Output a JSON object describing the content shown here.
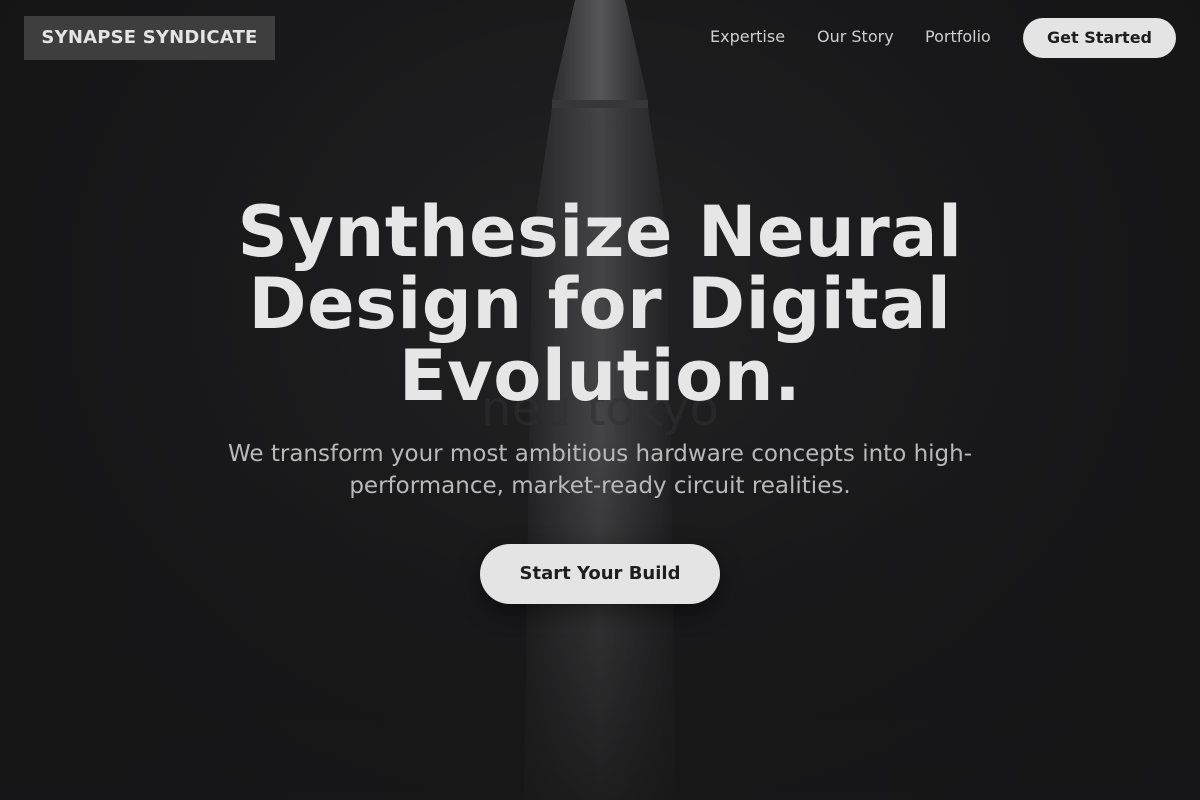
{
  "brand": {
    "name": "SYNAPSE SYNDICATE"
  },
  "nav": {
    "links": [
      {
        "label": "Expertise"
      },
      {
        "label": "Our Story"
      },
      {
        "label": "Portfolio"
      }
    ],
    "cta_label": "Get Started"
  },
  "hero": {
    "title": "Synthesize Neural Design for Digital Evolution.",
    "subtitle": "We transform your most ambitious hardware concepts into high-performance, market-ready circuit realities.",
    "cta_label": "Start Your Build",
    "background_image": "pen-illustration"
  },
  "colors": {
    "background": "#1d1d1e",
    "button_bg": "#e4e4e4",
    "button_text": "#1e1e1e",
    "heading": "#e6e6e6",
    "body_text": "#b9b9b9",
    "brand_bg": "#3e3e3f"
  }
}
